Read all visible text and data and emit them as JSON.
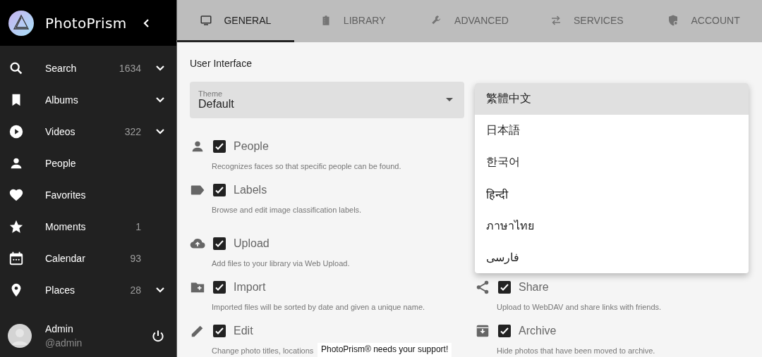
{
  "app": {
    "title": "PhotoPrism"
  },
  "sidebar": {
    "items": [
      {
        "label": "Search",
        "count": "1634",
        "expandable": true
      },
      {
        "label": "Albums",
        "expandable": true
      },
      {
        "label": "Videos",
        "count": "322",
        "expandable": true
      },
      {
        "label": "People",
        "expandable": false
      },
      {
        "label": "Favorites",
        "expandable": false
      },
      {
        "label": "Moments",
        "count": "1",
        "expandable": false
      },
      {
        "label": "Calendar",
        "count": "93",
        "expandable": false
      },
      {
        "label": "Places",
        "count": "28",
        "expandable": true
      }
    ],
    "user": {
      "name": "Admin",
      "handle": "@admin"
    }
  },
  "tabs": [
    {
      "label": "GENERAL",
      "selected": true
    },
    {
      "label": "LIBRARY",
      "selected": false
    },
    {
      "label": "ADVANCED",
      "selected": false
    },
    {
      "label": "SERVICES",
      "selected": false
    },
    {
      "label": "ACCOUNT",
      "selected": false
    }
  ],
  "section_title": "User Interface",
  "theme_select": {
    "label": "Theme",
    "value": "Default"
  },
  "language_menu": {
    "options": [
      {
        "label": "繁體中文",
        "selected": true
      },
      {
        "label": "日本語",
        "selected": false
      },
      {
        "label": "한국어",
        "selected": false
      },
      {
        "label": "हिन्दी",
        "selected": false
      },
      {
        "label": "ภาษาไทย",
        "selected": false
      },
      {
        "label": "فارسی",
        "selected": false
      }
    ]
  },
  "features": [
    {
      "label": "People",
      "checked": true,
      "description": "Recognizes faces so that specific people can be found."
    },
    {
      "label": "Labels",
      "checked": true,
      "description": "Browse and edit image classification labels."
    },
    {
      "label": "Upload",
      "checked": true,
      "description": "Add files to your library via Web Upload."
    },
    {
      "label": "Import",
      "checked": true,
      "description": "Imported files will be sorted by date and given a unique name."
    },
    {
      "label": "Share",
      "checked": true,
      "description": "Upload to WebDAV and share links with friends."
    },
    {
      "label": "Edit",
      "checked": true,
      "description": "Change photo titles, locations"
    },
    {
      "label": "Archive",
      "checked": true,
      "description": "Hide photos that have been moved to archive."
    }
  ],
  "toast": {
    "text": "PhotoPrism® needs your support!"
  }
}
